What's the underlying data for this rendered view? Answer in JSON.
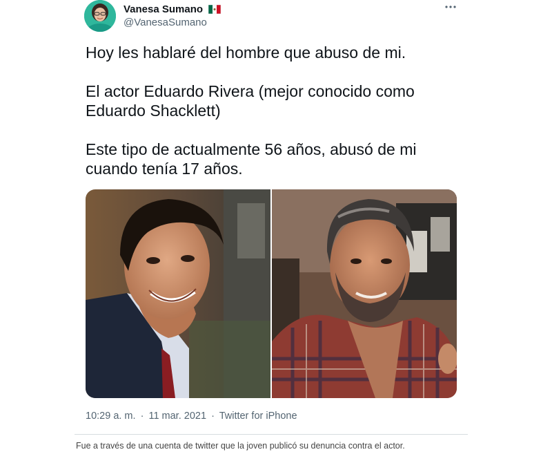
{
  "tweet": {
    "display_name": "Vanesa Sumano",
    "flag_icon": "mexico-flag-icon",
    "handle": "@VanesaSumano",
    "more_icon": "more-options-icon",
    "paragraphs": [
      "Hoy les hablaré del hombre que abuso de mi.",
      "El actor Eduardo Rivera (mejor conocido como Eduardo Shacklett)",
      "Este tipo de actualmente 56 años, abusó de mi cuando tenía 17 años."
    ],
    "time": "10:29 a. m.",
    "separator": "·",
    "date": "11 mar. 2021",
    "source": "Twitter for iPhone"
  },
  "caption": "Fue a través de una cuenta de twitter que la joven publicó su denuncia contra el actor.",
  "colors": {
    "text": "#0f1419",
    "secondary": "#536471",
    "divider": "#d6dce0"
  }
}
